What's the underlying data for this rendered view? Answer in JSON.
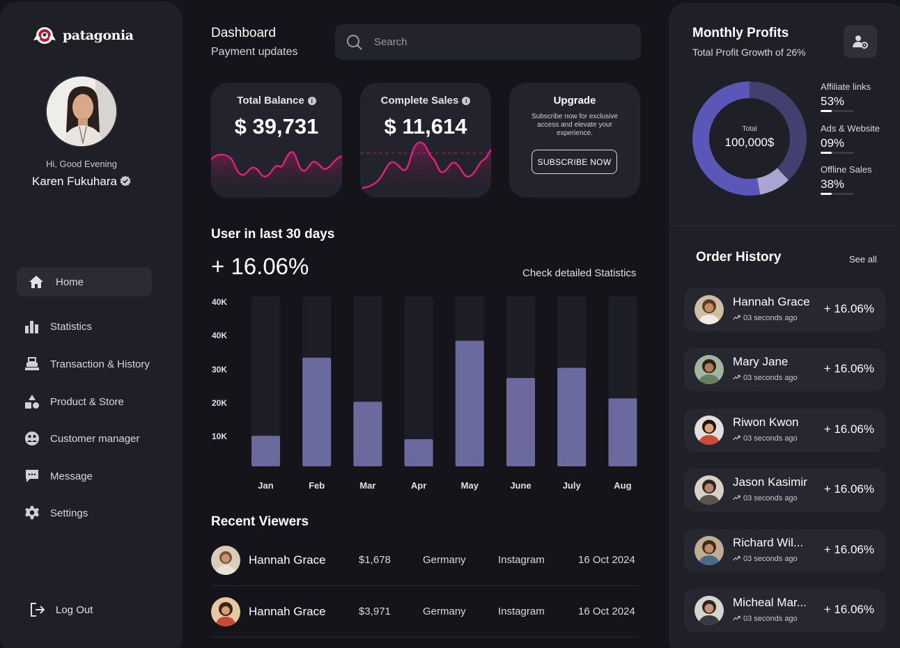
{
  "brand": {
    "name": "patagonia"
  },
  "user": {
    "greeting": "Hi, Good Evening",
    "name": "Karen Fukuhara"
  },
  "nav": {
    "items": [
      {
        "label": "Home",
        "icon": "home-icon",
        "active": true
      },
      {
        "label": "Statistics",
        "icon": "bar-chart-icon"
      },
      {
        "label": "Transaction & History",
        "icon": "register-icon"
      },
      {
        "label": "Product & Store",
        "icon": "shapes-icon"
      },
      {
        "label": "Customer manager",
        "icon": "customers-icon"
      },
      {
        "label": "Message",
        "icon": "message-icon"
      },
      {
        "label": "Settings",
        "icon": "gear-icon"
      }
    ],
    "logout": "Log Out"
  },
  "header": {
    "title": "Dashboard",
    "subtitle": "Payment updates",
    "search_placeholder": "Search"
  },
  "cards": {
    "balance": {
      "label": "Total Balance",
      "value": "$ 39,731"
    },
    "sales": {
      "label": "Complete Sales",
      "value": "$ 11,614"
    },
    "upgrade": {
      "title": "Upgrade",
      "description": "Subscribe now for exclusive access and elevate your experience.",
      "button": "SUBSCRIBE NOW"
    }
  },
  "users": {
    "title": "User in last 30 days",
    "percent": "+ 16.06%",
    "link": "Check detailed Statistics"
  },
  "chart_data": {
    "type": "bar",
    "categories": [
      "Jan",
      "Feb",
      "Mar",
      "Apr",
      "May",
      "June",
      "July",
      "Aug"
    ],
    "values": [
      9,
      32,
      19,
      8,
      37,
      26,
      29,
      20
    ],
    "y_tick_labels": [
      "40K",
      "40K",
      "30K",
      "20K",
      "10K"
    ],
    "ylim": [
      0,
      50
    ],
    "bar_color": "#6b6a9e",
    "track_color": "#1e1e26"
  },
  "viewers": {
    "title": "Recent Viewers",
    "rows": [
      {
        "name": "Hannah Grace",
        "amount": "$1,678",
        "country": "Germany",
        "source": "Instagram",
        "date": "16 Oct 2024"
      },
      {
        "name": "Hannah Grace",
        "amount": "$3,971",
        "country": "Germany",
        "source": "Instagram",
        "date": "16 Oct 2024"
      }
    ]
  },
  "profits": {
    "title": "Monthly Profits",
    "subtitle": "Total Profit Growth of 26%",
    "total_label": "Total",
    "total_value": "100,000$",
    "legend": [
      {
        "name": "Affiliate links",
        "value": "53%",
        "fraction": 0.53,
        "color": "#5a57b8"
      },
      {
        "name": "Ads & Website",
        "value": "09%",
        "fraction": 0.09,
        "color": "#a8a6d0"
      },
      {
        "name": "Offline Sales",
        "value": "38%",
        "fraction": 0.38,
        "color": "#42406e"
      }
    ]
  },
  "orders": {
    "title": "Order History",
    "see_all": "See all",
    "items": [
      {
        "name": "Hannah Grace",
        "time": "03 seconds ago",
        "pct": "+ 16.06%"
      },
      {
        "name": "Mary Jane",
        "time": "03 seconds ago",
        "pct": "+ 16.06%"
      },
      {
        "name": "Riwon Kwon",
        "time": "03 seconds ago",
        "pct": "+ 16.06%"
      },
      {
        "name": "Jason Kasimir",
        "time": "03 seconds ago",
        "pct": "+ 16.06%"
      },
      {
        "name": "Richard Wil...",
        "time": "03 seconds ago",
        "pct": "+ 16.06%"
      },
      {
        "name": "Micheal Mar...",
        "time": "03 seconds ago",
        "pct": "+ 16.06%"
      }
    ]
  }
}
